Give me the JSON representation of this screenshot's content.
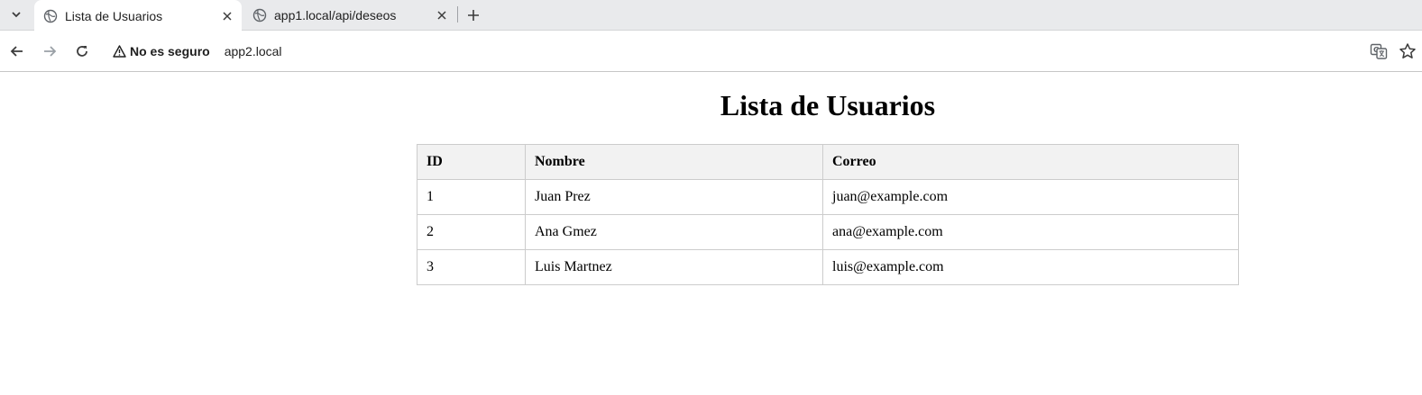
{
  "browser": {
    "tabs": [
      {
        "title": "Lista de Usuarios",
        "active": true
      },
      {
        "title": "app1.local/api/deseos",
        "active": false
      }
    ],
    "security_label": "No es seguro",
    "url": "app2.local"
  },
  "page": {
    "title": "Lista de Usuarios",
    "table": {
      "headers": [
        "ID",
        "Nombre",
        "Correo"
      ],
      "rows": [
        [
          "1",
          "Juan Prez",
          "juan@example.com"
        ],
        [
          "2",
          "Ana Gmez",
          "ana@example.com"
        ],
        [
          "3",
          "Luis Martnez",
          "luis@example.com"
        ]
      ]
    }
  },
  "colors": {
    "tabstrip_bg": "#e9eaec",
    "table_header_bg": "#f2f2f2",
    "table_border": "#cccccc"
  }
}
